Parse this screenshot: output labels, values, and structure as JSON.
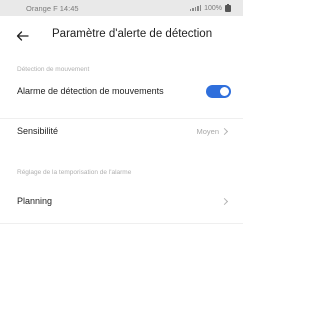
{
  "status_bar": {
    "carrier_time": "Orange F  14:45",
    "battery": "100%"
  },
  "header": {
    "title": "Paramètre d'alerte de détection"
  },
  "sections": {
    "motion": {
      "label": "Détection de mouvement",
      "alarm_label": "Alarme de détection de mouvements",
      "alarm_enabled": true,
      "sensitivity_label": "Sensibilité",
      "sensitivity_value": "Moyen"
    },
    "timing": {
      "label": "Réglage de la temporisation de l'alarme",
      "planning_label": "Planning"
    }
  },
  "colors": {
    "toggle_on": "#2f6fdc",
    "section_label": "#b0b0b0"
  },
  "icons": [
    "back-arrow-icon",
    "chevron-right-icon",
    "signal-icon",
    "battery-icon"
  ]
}
